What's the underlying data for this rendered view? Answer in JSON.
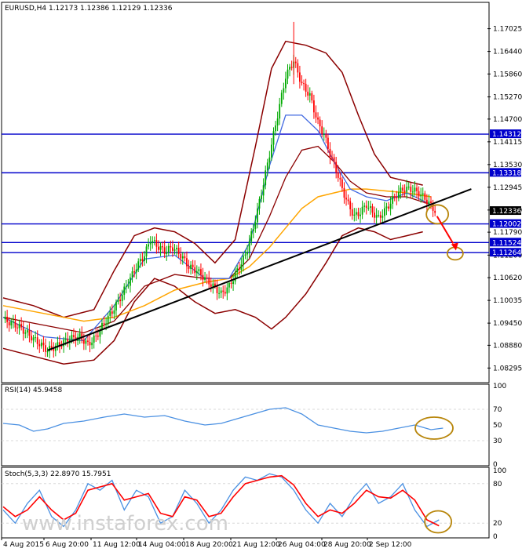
{
  "chart_data": [
    {
      "type": "candlestick",
      "header": "EURUSD,H4  1.12173 1.12386 1.12129 1.12336",
      "ylim": [
        1.08,
        1.174
      ],
      "y_ticks": [
        "1.17025",
        "1.16440",
        "1.15860",
        "1.15270",
        "1.14700",
        "1.14115",
        "1.13530",
        "1.12945",
        "1.12360",
        "1.11790",
        "1.11200",
        "1.10620",
        "1.10035",
        "1.09450",
        "1.08880",
        "1.08295"
      ],
      "x_ticks": [
        "4 Aug 2015",
        "6 Aug 20:00",
        "11 Aug 12:00",
        "14 Aug 04:00",
        "18 Aug 20:00",
        "21 Aug 12:00",
        "26 Aug 04:00",
        "28 Aug 20:00",
        "2 Sep 12:00"
      ],
      "price_path": [
        [
          0,
          1.0955
        ],
        [
          8,
          1.0935
        ],
        [
          15,
          1.0905
        ],
        [
          22,
          1.0875
        ],
        [
          28,
          1.089
        ],
        [
          33,
          1.0905
        ],
        [
          38,
          1.091
        ],
        [
          42,
          1.089
        ],
        [
          46,
          1.091
        ],
        [
          50,
          1.0945
        ],
        [
          54,
          1.0975
        ],
        [
          58,
          1.101
        ],
        [
          62,
          1.105
        ],
        [
          66,
          1.109
        ],
        [
          70,
          1.112
        ],
        [
          73,
          1.116
        ],
        [
          76,
          1.1145
        ],
        [
          80,
          1.113
        ],
        [
          84,
          1.114
        ],
        [
          88,
          1.112
        ],
        [
          92,
          1.109
        ],
        [
          96,
          1.108
        ],
        [
          100,
          1.106
        ],
        [
          104,
          1.104
        ],
        [
          108,
          1.102
        ],
        [
          112,
          1.104
        ],
        [
          116,
          1.108
        ],
        [
          120,
          1.112
        ],
        [
          124,
          1.119
        ],
        [
          128,
          1.128
        ],
        [
          132,
          1.138
        ],
        [
          136,
          1.148
        ],
        [
          140,
          1.158
        ],
        [
          144,
          1.162
        ],
        [
          148,
          1.156
        ],
        [
          152,
          1.153
        ],
        [
          156,
          1.146
        ],
        [
          159,
          1.143
        ],
        [
          162,
          1.138
        ],
        [
          165,
          1.134
        ],
        [
          168,
          1.129
        ],
        [
          171,
          1.125
        ],
        [
          174,
          1.122
        ],
        [
          177,
          1.123
        ],
        [
          180,
          1.125
        ],
        [
          183,
          1.123
        ],
        [
          186,
          1.1215
        ],
        [
          190,
          1.124
        ],
        [
          194,
          1.127
        ],
        [
          198,
          1.129
        ],
        [
          202,
          1.129
        ],
        [
          206,
          1.128
        ],
        [
          210,
          1.126
        ],
        [
          214,
          1.1234
        ]
      ],
      "overlays": {
        "bb_upper": [
          [
            0,
            1.101
          ],
          [
            15,
            1.099
          ],
          [
            30,
            1.096
          ],
          [
            45,
            1.098
          ],
          [
            55,
            1.108
          ],
          [
            65,
            1.117
          ],
          [
            75,
            1.119
          ],
          [
            85,
            1.118
          ],
          [
            95,
            1.115
          ],
          [
            105,
            1.11
          ],
          [
            115,
            1.116
          ],
          [
            125,
            1.14
          ],
          [
            133,
            1.16
          ],
          [
            140,
            1.167
          ],
          [
            150,
            1.166
          ],
          [
            160,
            1.164
          ],
          [
            168,
            1.159
          ],
          [
            176,
            1.148
          ],
          [
            184,
            1.138
          ],
          [
            192,
            1.132
          ],
          [
            200,
            1.131
          ],
          [
            208,
            1.13
          ]
        ],
        "bb_lower": [
          [
            0,
            1.088
          ],
          [
            15,
            1.086
          ],
          [
            30,
            1.084
          ],
          [
            45,
            1.085
          ],
          [
            55,
            1.09
          ],
          [
            65,
            1.1
          ],
          [
            75,
            1.106
          ],
          [
            85,
            1.104
          ],
          [
            95,
            1.1
          ],
          [
            105,
            1.097
          ],
          [
            115,
            1.098
          ],
          [
            125,
            1.096
          ],
          [
            133,
            1.093
          ],
          [
            140,
            1.096
          ],
          [
            150,
            1.102
          ],
          [
            160,
            1.11
          ],
          [
            168,
            1.117
          ],
          [
            176,
            1.119
          ],
          [
            184,
            1.118
          ],
          [
            192,
            1.116
          ],
          [
            200,
            1.117
          ],
          [
            208,
            1.118
          ]
        ],
        "ma_fast": [
          [
            0,
            1.096
          ],
          [
            20,
            1.091
          ],
          [
            40,
            1.09
          ],
          [
            55,
            1.099
          ],
          [
            70,
            1.111
          ],
          [
            85,
            1.112
          ],
          [
            100,
            1.106
          ],
          [
            112,
            1.106
          ],
          [
            122,
            1.115
          ],
          [
            132,
            1.135
          ],
          [
            140,
            1.148
          ],
          [
            148,
            1.148
          ],
          [
            156,
            1.144
          ],
          [
            164,
            1.136
          ],
          [
            172,
            1.129
          ],
          [
            180,
            1.127
          ],
          [
            190,
            1.126
          ],
          [
            200,
            1.128
          ],
          [
            212,
            1.125
          ]
        ],
        "ma_slow": [
          [
            0,
            1.096
          ],
          [
            20,
            1.094
          ],
          [
            40,
            1.092
          ],
          [
            55,
            1.095
          ],
          [
            70,
            1.104
          ],
          [
            85,
            1.107
          ],
          [
            100,
            1.106
          ],
          [
            112,
            1.106
          ],
          [
            122,
            1.111
          ],
          [
            132,
            1.122
          ],
          [
            140,
            1.132
          ],
          [
            148,
            1.139
          ],
          [
            156,
            1.14
          ],
          [
            164,
            1.136
          ],
          [
            172,
            1.131
          ],
          [
            180,
            1.128
          ],
          [
            190,
            1.127
          ],
          [
            200,
            1.127
          ],
          [
            212,
            1.125
          ]
        ],
        "ma_long": [
          [
            0,
            1.099
          ],
          [
            20,
            1.097
          ],
          [
            40,
            1.095
          ],
          [
            55,
            1.096
          ],
          [
            70,
            1.099
          ],
          [
            85,
            1.103
          ],
          [
            100,
            1.105
          ],
          [
            112,
            1.106
          ],
          [
            122,
            1.109
          ],
          [
            132,
            1.114
          ],
          [
            140,
            1.119
          ],
          [
            148,
            1.124
          ],
          [
            156,
            1.127
          ],
          [
            164,
            1.128
          ],
          [
            172,
            1.129
          ],
          [
            180,
            1.129
          ],
          [
            190,
            1.1285
          ],
          [
            200,
            1.128
          ],
          [
            212,
            1.127
          ]
        ]
      },
      "horizontal_levels": [
        {
          "value": 1.14312,
          "label": "1.14312",
          "color": "#0000cc"
        },
        {
          "value": 1.13318,
          "label": "1.13318",
          "color": "#0000cc"
        },
        {
          "value": 1.12002,
          "label": "1.12002",
          "color": "#0000cc"
        },
        {
          "value": 1.11524,
          "label": "1.11524",
          "color": "#0000cc"
        },
        {
          "value": 1.11264,
          "label": "1.11264",
          "color": "#0000cc"
        }
      ],
      "current_price": {
        "value": 1.12336,
        "label": "1.12336"
      },
      "trendline": [
        [
          22,
          1.0875
        ],
        [
          232,
          1.129
        ]
      ],
      "colors": {
        "bull": "#00aa00",
        "bear": "#ff0000",
        "bb": "#8b0000",
        "ma_fast": "#4169e1",
        "ma_slow": "#8b0000",
        "ma_long": "#ffa500",
        "level": "#0000cc",
        "annot": "#b8860b"
      }
    },
    {
      "type": "line",
      "header": "RSI(14) 45.9458",
      "ylim": [
        0,
        100
      ],
      "y_ticks": [
        "100",
        "70",
        "50",
        "30",
        "0"
      ],
      "series": [
        {
          "values": [
            [
              0,
              52
            ],
            [
              8,
              50
            ],
            [
              15,
              42
            ],
            [
              22,
              45
            ],
            [
              30,
              52
            ],
            [
              40,
              55
            ],
            [
              50,
              60
            ],
            [
              60,
              64
            ],
            [
              70,
              60
            ],
            [
              80,
              62
            ],
            [
              90,
              55
            ],
            [
              100,
              50
            ],
            [
              108,
              52
            ],
            [
              116,
              58
            ],
            [
              124,
              64
            ],
            [
              132,
              70
            ],
            [
              140,
              72
            ],
            [
              148,
              64
            ],
            [
              156,
              50
            ],
            [
              164,
              46
            ],
            [
              172,
              42
            ],
            [
              180,
              40
            ],
            [
              188,
              42
            ],
            [
              196,
              46
            ],
            [
              204,
              50
            ],
            [
              212,
              44
            ],
            [
              218,
              46
            ]
          ]
        }
      ],
      "color": "#4a90e2"
    },
    {
      "type": "line",
      "header": "Stoch(5,3,3) 22.8970 15.7951",
      "ylim": [
        0,
        100
      ],
      "y_ticks": [
        "100",
        "80",
        "20",
        "0"
      ],
      "series": [
        {
          "values": [
            [
              0,
              40
            ],
            [
              6,
              20
            ],
            [
              12,
              50
            ],
            [
              18,
              70
            ],
            [
              24,
              30
            ],
            [
              30,
              15
            ],
            [
              36,
              40
            ],
            [
              42,
              80
            ],
            [
              48,
              70
            ],
            [
              54,
              85
            ],
            [
              60,
              40
            ],
            [
              66,
              70
            ],
            [
              72,
              60
            ],
            [
              78,
              20
            ],
            [
              84,
              30
            ],
            [
              90,
              70
            ],
            [
              96,
              50
            ],
            [
              102,
              20
            ],
            [
              108,
              40
            ],
            [
              114,
              70
            ],
            [
              120,
              90
            ],
            [
              126,
              85
            ],
            [
              132,
              95
            ],
            [
              138,
              90
            ],
            [
              144,
              70
            ],
            [
              150,
              40
            ],
            [
              156,
              20
            ],
            [
              162,
              50
            ],
            [
              168,
              30
            ],
            [
              174,
              60
            ],
            [
              180,
              80
            ],
            [
              186,
              50
            ],
            [
              192,
              60
            ],
            [
              198,
              80
            ],
            [
              204,
              40
            ],
            [
              210,
              15
            ],
            [
              216,
              25
            ]
          ]
        },
        {
          "values": [
            [
              0,
              45
            ],
            [
              6,
              30
            ],
            [
              12,
              40
            ],
            [
              18,
              60
            ],
            [
              24,
              40
            ],
            [
              30,
              25
            ],
            [
              36,
              35
            ],
            [
              42,
              70
            ],
            [
              48,
              75
            ],
            [
              54,
              80
            ],
            [
              60,
              55
            ],
            [
              66,
              60
            ],
            [
              72,
              65
            ],
            [
              78,
              35
            ],
            [
              84,
              30
            ],
            [
              90,
              60
            ],
            [
              96,
              55
            ],
            [
              102,
              30
            ],
            [
              108,
              35
            ],
            [
              114,
              60
            ],
            [
              120,
              80
            ],
            [
              126,
              85
            ],
            [
              132,
              90
            ],
            [
              138,
              92
            ],
            [
              144,
              78
            ],
            [
              150,
              50
            ],
            [
              156,
              30
            ],
            [
              162,
              40
            ],
            [
              168,
              35
            ],
            [
              174,
              50
            ],
            [
              180,
              70
            ],
            [
              186,
              60
            ],
            [
              192,
              58
            ],
            [
              198,
              70
            ],
            [
              204,
              55
            ],
            [
              210,
              25
            ],
            [
              216,
              16
            ]
          ]
        }
      ],
      "colors": [
        "#4a90e2",
        "#ff0000"
      ]
    }
  ],
  "watermark": "www.instaforex.com"
}
